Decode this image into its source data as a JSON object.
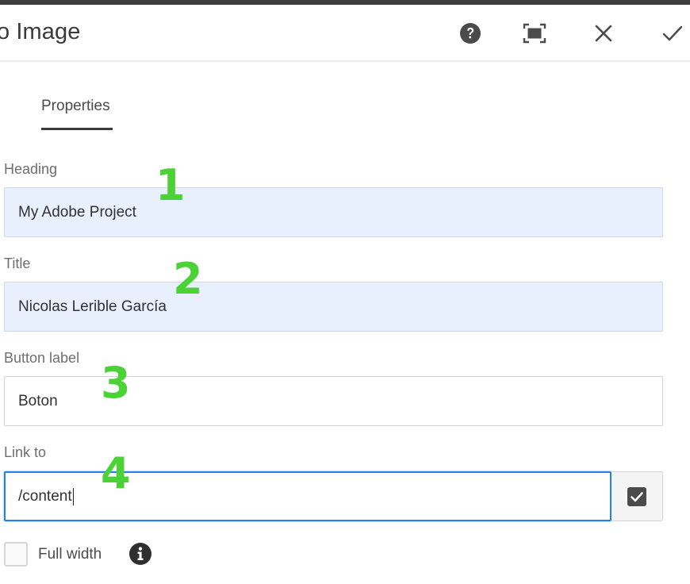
{
  "dialog": {
    "title": "o Image",
    "help_icon": "help-icon",
    "fullscreen_icon": "fullscreen-icon",
    "close_icon": "close-icon",
    "done_icon": "checkmark-icon"
  },
  "tabs": [
    {
      "label": "Properties",
      "active": true
    }
  ],
  "fields": {
    "heading": {
      "label": "Heading",
      "value": "My Adobe Project",
      "annotation": "1"
    },
    "title": {
      "label": "Title",
      "value": "Nicolas Lerible García",
      "annotation": "2"
    },
    "button_label": {
      "label": "Button label",
      "value": "Boton",
      "annotation": "3"
    },
    "link_to": {
      "label": "Link to",
      "value": "/content",
      "annotation": "4",
      "picker_icon": "checkbox-checked-icon"
    }
  },
  "full_width": {
    "label": "Full width",
    "checked": false,
    "info_icon": "info-icon"
  },
  "colors": {
    "annotation": "#4cd137",
    "focus": "#2680eb",
    "autofill": "#e8f0fe",
    "topbar": "#3d3d3d"
  }
}
